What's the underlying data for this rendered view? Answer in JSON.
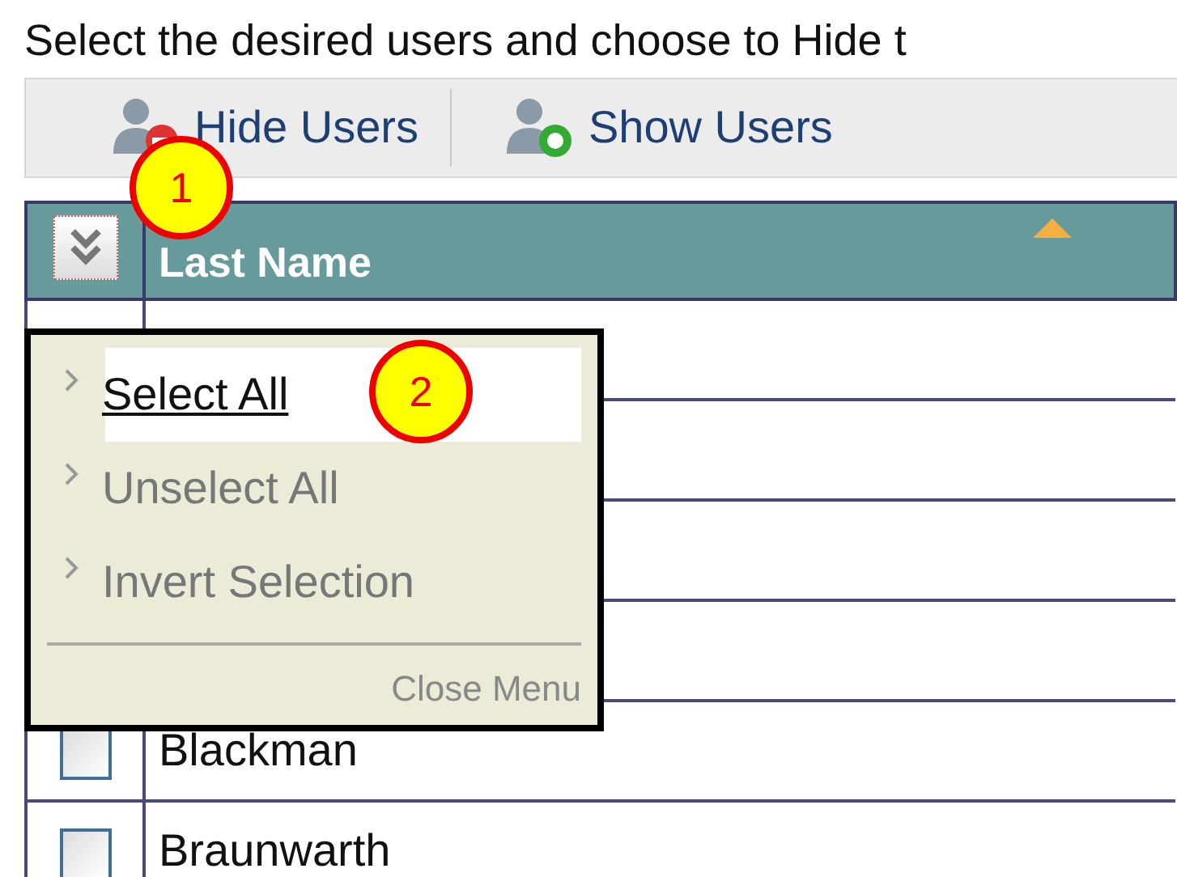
{
  "instruction": "Select the desired users and choose to Hide t",
  "toolbar": [
    {
      "label": "Hide Users",
      "kind": "hide"
    },
    {
      "label": "Show Users",
      "kind": "show"
    }
  ],
  "table": {
    "columns": [
      {
        "label": "Last Name",
        "sorted": true
      }
    ],
    "rows": [
      {
        "name": "Blackman",
        "checked": false
      },
      {
        "name": "Braunwarth",
        "checked": false
      }
    ]
  },
  "menu": {
    "items": [
      {
        "label": "Select All",
        "selected": true
      },
      {
        "label": "Unselect All",
        "selected": false
      },
      {
        "label": "Invert Selection",
        "selected": false
      }
    ],
    "close": "Close Menu"
  },
  "callouts": [
    {
      "label": "1",
      "kind": "toolbar"
    },
    {
      "label": "2",
      "kind": "menu"
    }
  ]
}
